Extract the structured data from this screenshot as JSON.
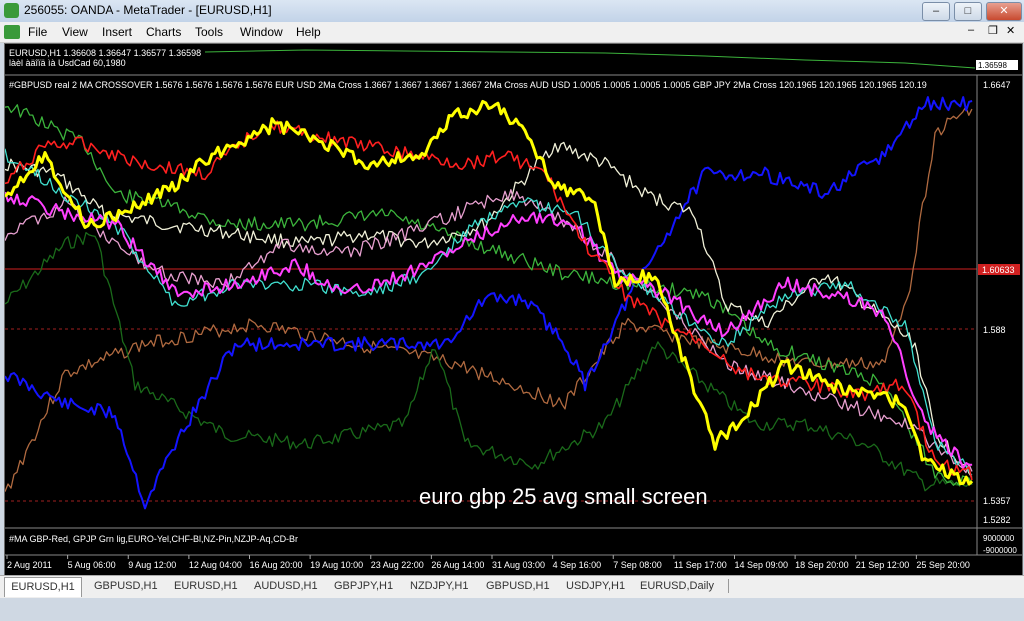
{
  "window": {
    "title": "256055: OANDA - MetaTrader - [EURUSD,H1]",
    "controls": [
      "–",
      "□",
      "✕"
    ],
    "doc_controls": [
      "–",
      "❐",
      "✕"
    ]
  },
  "menu": [
    "File",
    "View",
    "Insert",
    "Charts",
    "Tools",
    "Window",
    "Help"
  ],
  "top_pane": {
    "line1": "EURUSD,H1  1.36608 1.36647 1.36577 1.36598",
    "line2": "làèl àäîïä ìà UsdCad 60,1980",
    "price_label": "1.36598",
    "price_label2": "1.36598"
  },
  "main_pane": {
    "header": "#GBPUSD real 2 MA CROSSOVER 1.5676 1.5676 1.5676 1.5676  EUR USD 2Ma Cross  1.3667 1.3667 1.3667 1.3667  2Ma Cross AUD USD 1.0005 1.0005 1.0005 1.0005  GBP JPY 2Ma Cross  120.1965 120.1965 120.1965 120.19",
    "y_labels": [
      "1.6647",
      "1.6063",
      "1.588",
      "1.5357",
      "1.5282"
    ],
    "red_line_label": "1.60633",
    "annotation": "euro gbp 25 avg  small screen",
    "x_labels": [
      "2 Aug 2011",
      "5 Aug 06:00",
      "9 Aug 12:00",
      "12 Aug 04:00",
      "16 Aug 20:00",
      "19 Aug 10:00",
      "23 Aug 22:00",
      "26 Aug 14:00",
      "31 Aug 03:00",
      "4 Sep 16:00",
      "7 Sep 08:00",
      "11 Sep 17:00",
      "14 Sep 09:00",
      "18 Sep 20:00",
      "21 Sep 12:00",
      "25 Sep 20:00"
    ]
  },
  "bottom_pane": {
    "label": "#MA  GBP-Red, GPJP Grn lig,EURO-Yel,CHF-Bl,NZ-Pin,NZJP-Aq,CD-Br",
    "y_labels": [
      "9000000",
      "-9000000"
    ]
  },
  "tabs": [
    "EURUSD,H1",
    "GBPUSD,H1",
    "EURUSD,H1",
    "AUDUSD,H1",
    "GBPJPY,H1",
    "NZDJPY,H1",
    "GBPUSD,H1",
    "USDJPY,H1",
    "EURUSD,Daily"
  ],
  "colors": {
    "chart_bg": "#000000",
    "gbp": "#ff2020",
    "gbpjpy": "#3cb43c",
    "euro": "#ffff00",
    "chf": "#1414ff",
    "nz": "#ff40ff",
    "nzjp": "#40e0d0",
    "cd": "#b06a40",
    "dark_green": "#1a6a1a",
    "pink": "#e8a0d0",
    "white": "#f0f0d8"
  }
}
